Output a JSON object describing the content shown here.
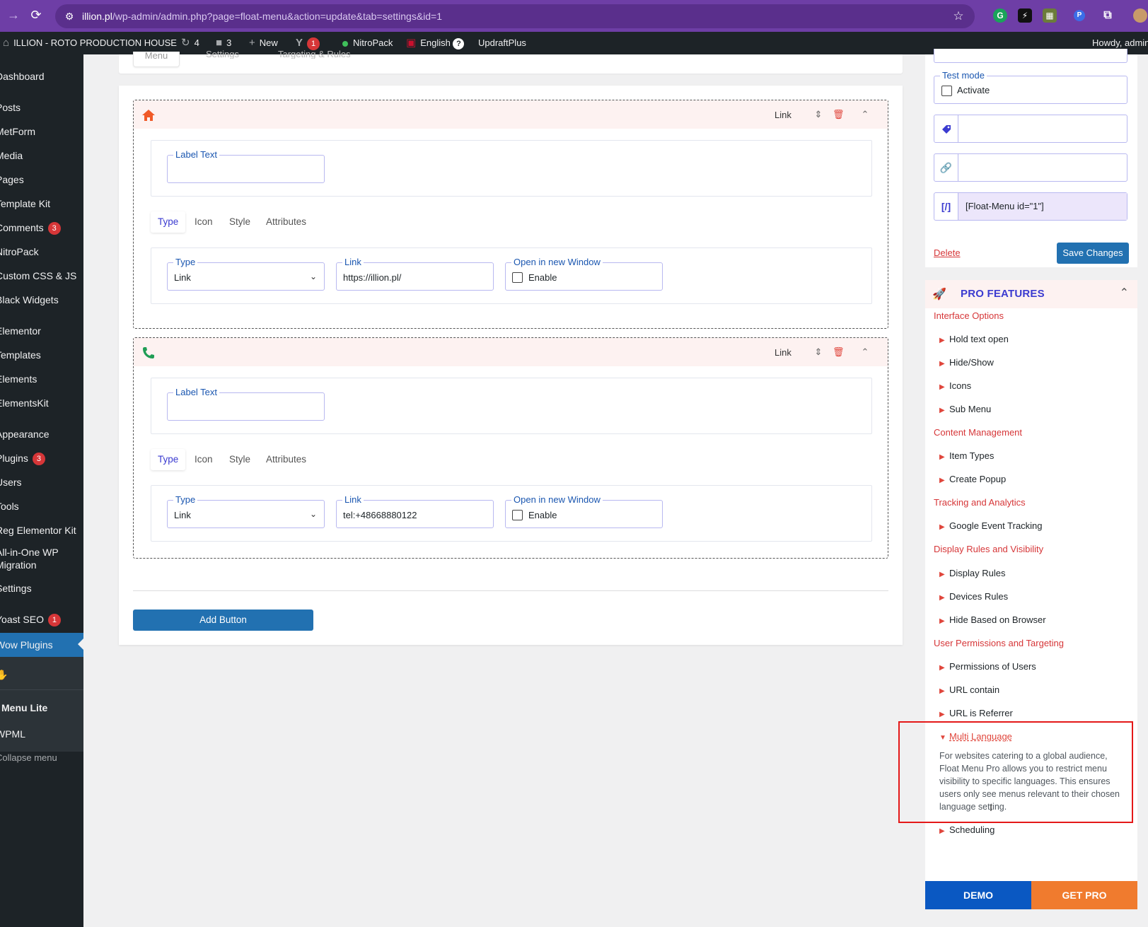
{
  "browser": {
    "url_host": "illion.pl",
    "url_path": "/wp-admin/admin.php?page=float-menu&action=update&tab=settings&id=1"
  },
  "adminbar": {
    "site_name": "ILLION - ROTO PRODUCTION HOUSE",
    "updates_count": "4",
    "comments_count": "3",
    "new_label": "New",
    "yoast_count": "1",
    "nitropack_label": "NitroPack",
    "language_label": "English",
    "updraft_label": "UpdraftPlus",
    "howdy_label": "Howdy, admin"
  },
  "sidebar": {
    "dashboard": "Dashboard",
    "posts": "Posts",
    "metform": "MetForm",
    "media": "Media",
    "pages": "Pages",
    "template_kit": "Template Kit",
    "comments": "Comments",
    "comments_badge": "3",
    "nitropack": "NitroPack",
    "custom_css": "Custom CSS & JS",
    "black_widgets": "Black Widgets",
    "elementor": "Elementor",
    "templates": "Templates",
    "elements": "Elements",
    "elementskit": "ElementsKit",
    "appearance": "Appearance",
    "plugins": "Plugins",
    "plugins_badge": "3",
    "users": "Users",
    "tools": "Tools",
    "reg_elementor_kit": "Reg Elementor Kit",
    "aio_migration_1": "All-in-One WP",
    "aio_migration_2": "Migration",
    "settings": "Settings",
    "yoast": "Yoast SEO",
    "yoast_badge": "1",
    "wow_plugins": "Wow Plugins",
    "float_menu_lite": "Menu Lite",
    "wpml": "WPML",
    "collapse": "Collapse menu"
  },
  "tabs": {
    "menu": "Menu",
    "settings": "Settings",
    "targeting": "Targeting & Rules"
  },
  "items": [
    {
      "head_type": "Link",
      "label_legend": "Label Text",
      "label_value": "",
      "subtabs": [
        "Type",
        "Icon",
        "Style",
        "Attributes"
      ],
      "type_legend": "Type",
      "type_value": "Link",
      "link_legend": "Link",
      "link_value": "https://illion.pl/",
      "window_legend": "Open in new Window",
      "window_label": "Enable"
    },
    {
      "head_type": "Link",
      "label_legend": "Label Text",
      "label_value": "",
      "subtabs": [
        "Type",
        "Icon",
        "Style",
        "Attributes"
      ],
      "type_legend": "Type",
      "type_value": "Link",
      "link_legend": "Link",
      "link_value": "tel:+48668880122",
      "window_legend": "Open in new Window",
      "window_label": "Enable"
    }
  ],
  "add_button": "Add Button",
  "right": {
    "test_mode_legend": "Test mode",
    "activate_label": "Activate",
    "shortcode": "[Float-Menu id=\"1\"]",
    "shortcode_icon": "[/]",
    "delete_label": "Delete",
    "save_label": "Save Changes"
  },
  "pro": {
    "title": "PRO FEATURES",
    "cat_interface": "Interface Options",
    "hold_text": "Hold text open",
    "hide_show": "Hide/Show",
    "icons": "Icons",
    "sub_menu": "Sub Menu",
    "cat_content": "Content Management",
    "item_types": "Item Types",
    "create_popup": "Create Popup",
    "cat_tracking": "Tracking and Analytics",
    "google_tracking": "Google Event Tracking",
    "cat_display": "Display Rules and Visibility",
    "display_rules": "Display Rules",
    "devices_rules": "Devices Rules",
    "hide_browser": "Hide Based on Browser",
    "cat_users": "User Permissions and Targeting",
    "permissions": "Permissions of Users",
    "url_contain": "URL contain",
    "url_referrer": "URL is Referrer",
    "multi_language": "Multi Language",
    "multi_language_desc": "For websites catering to a global audience, Float Menu Pro allows you to restrict menu visibility to specific languages. This ensures users only see menus relevant to their chosen language setting.",
    "scheduling": "Scheduling",
    "demo": "DEMO",
    "get_pro": "GET PRO"
  },
  "colors": {
    "accent_purple": "#6e3ea6",
    "wp_blue": "#2271b1",
    "pro_red": "#d63638",
    "get_pro_orange": "#f07b2e",
    "demo_blue": "#0a58c2"
  }
}
